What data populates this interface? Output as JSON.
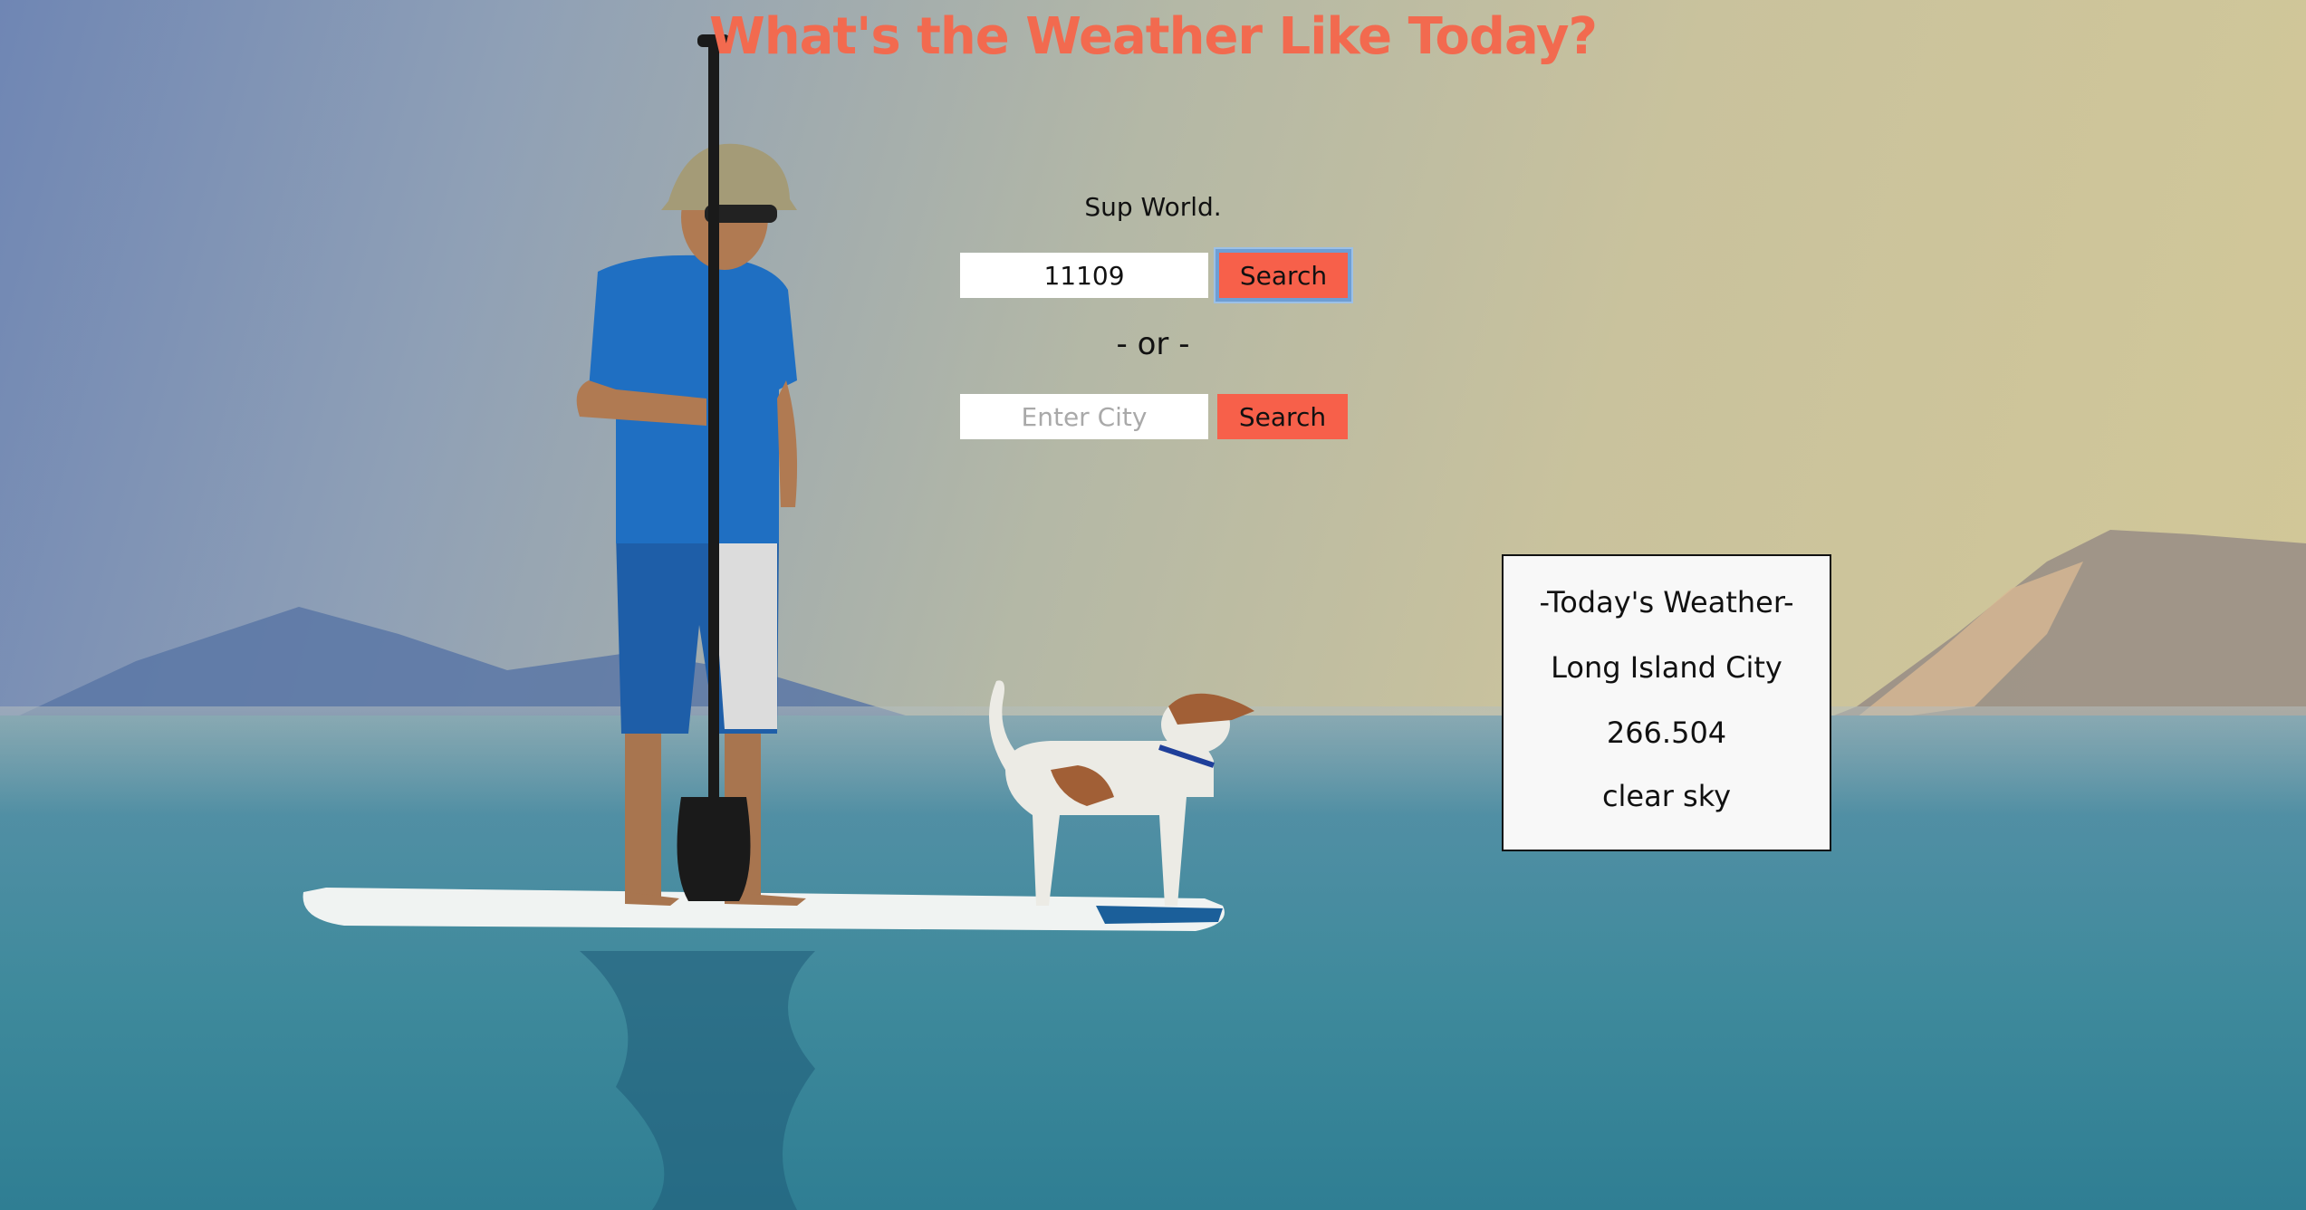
{
  "page": {
    "title": "What's the Weather Like Today?",
    "greeting": "Sup World."
  },
  "zip_search": {
    "value": "11109",
    "button_label": "Search"
  },
  "separator": "- or -",
  "city_search": {
    "value": "",
    "placeholder": "Enter City",
    "button_label": "Search"
  },
  "weather": {
    "heading": "-Today's Weather-",
    "city": "Long Island City",
    "temperature": "266.504",
    "description": "clear sky"
  },
  "colors": {
    "accent": "#f7604a",
    "title": "#f26a4f",
    "card_bg": "#f8f8f8"
  }
}
